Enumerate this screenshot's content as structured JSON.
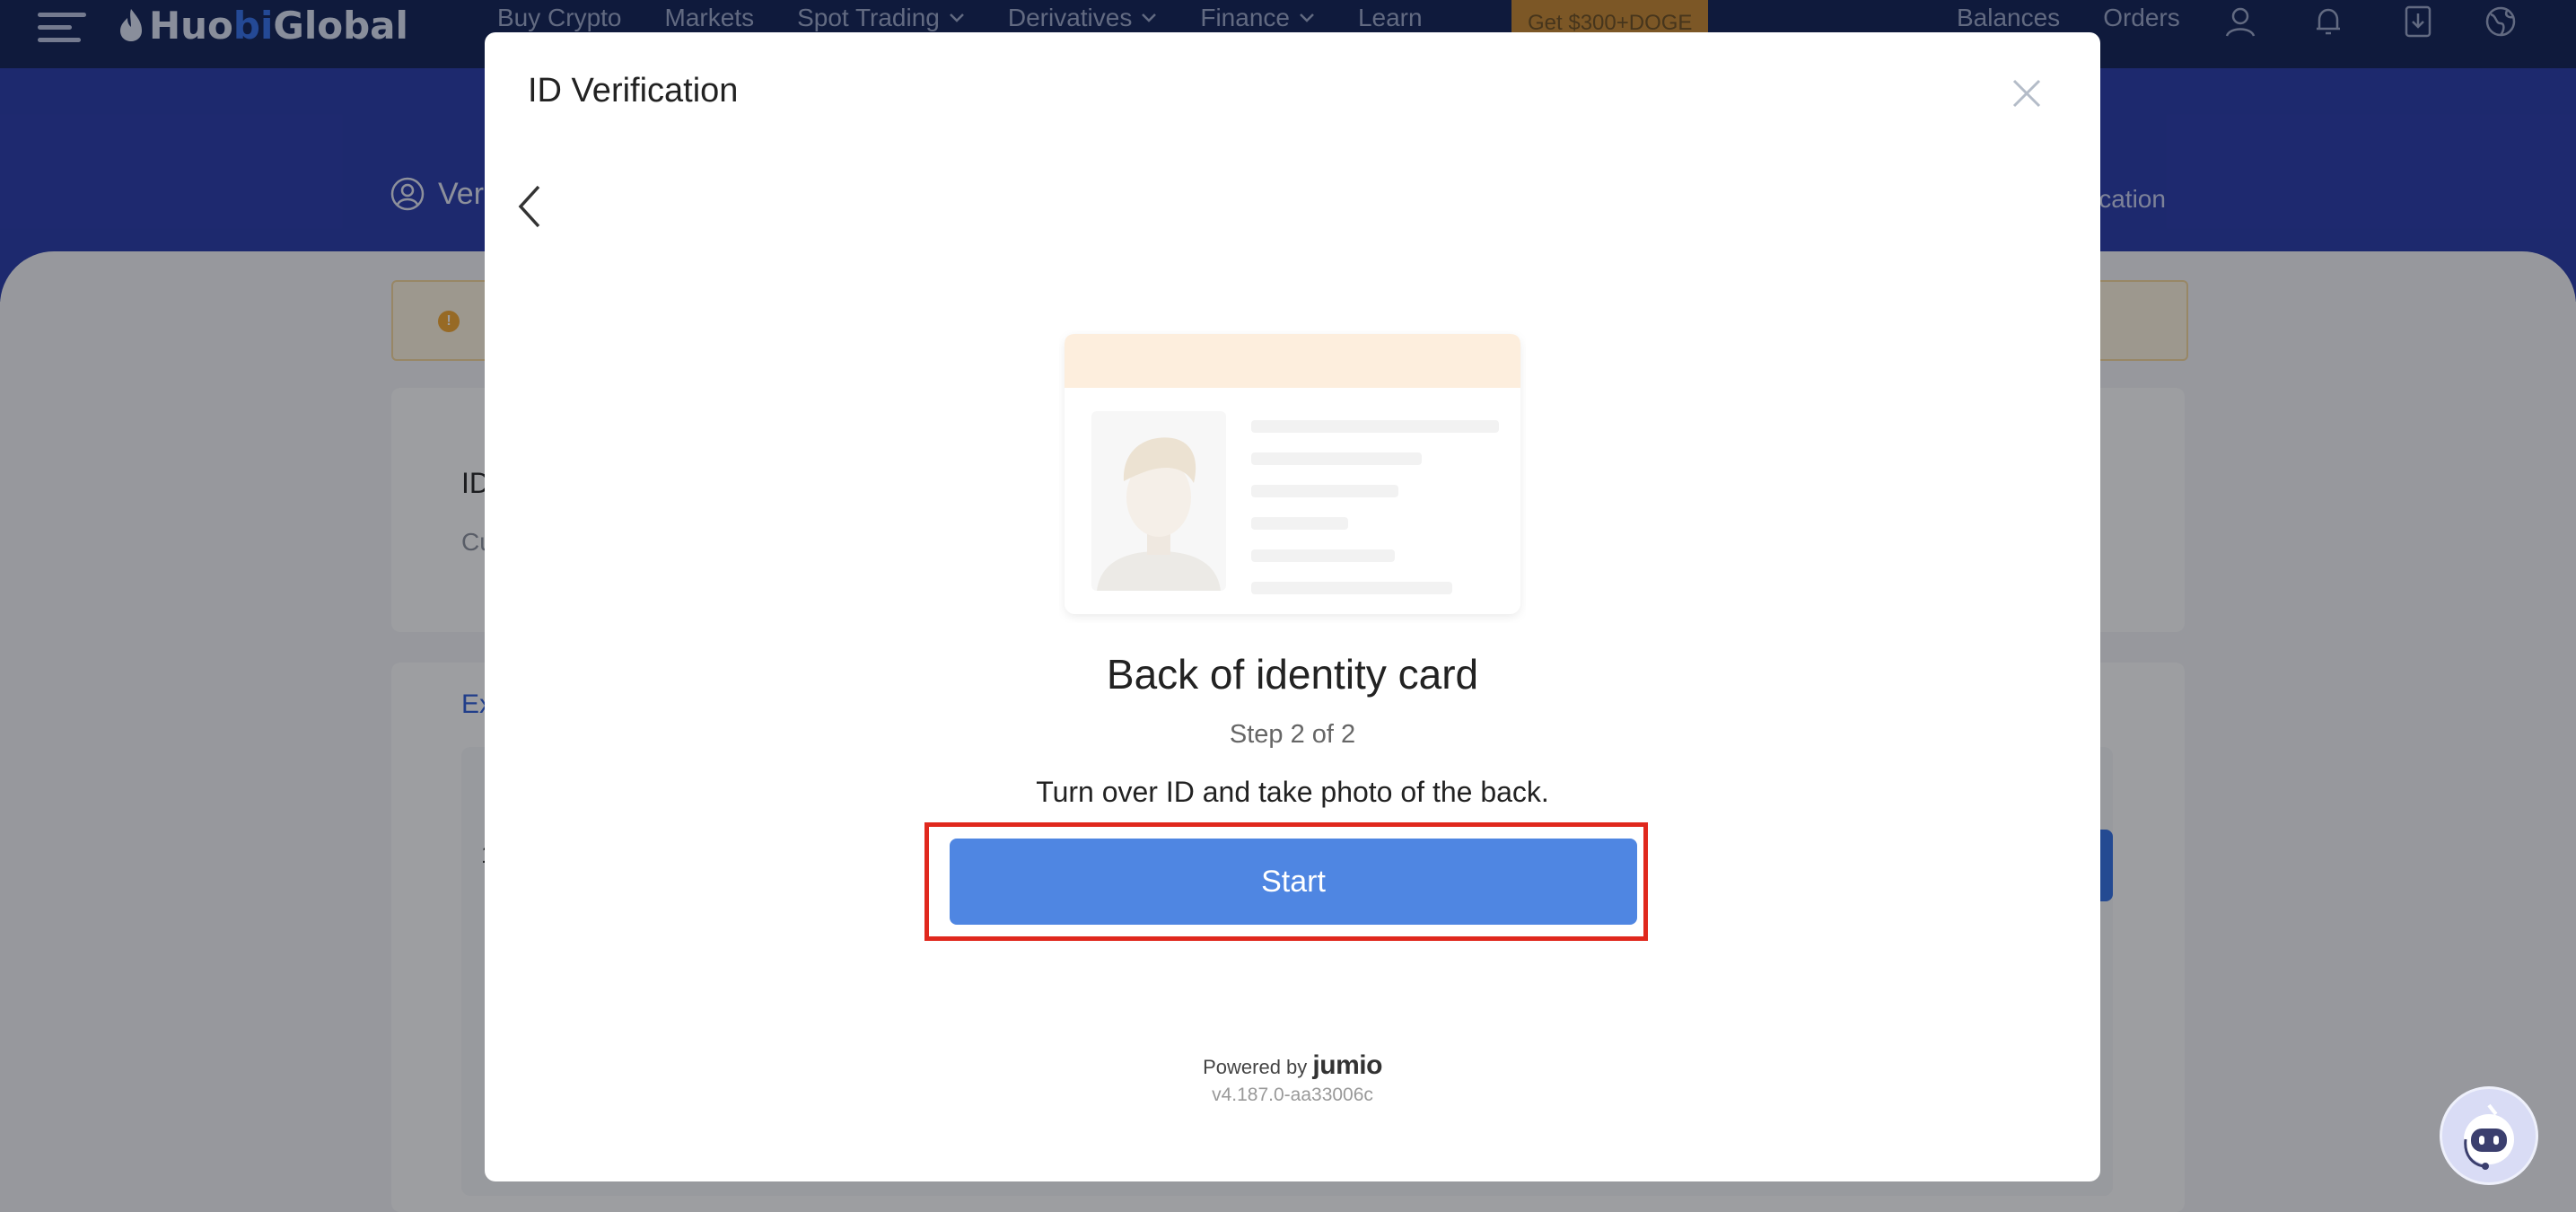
{
  "nav": {
    "logo_left": "Huo",
    "logo_mid": "bi",
    "logo_right": " Global",
    "links": [
      "Buy Crypto",
      "Markets",
      "Spot Trading",
      "Derivatives",
      "Finance",
      "Learn"
    ],
    "promo": "Get $300+DOGE",
    "balances": "Balances",
    "orders": "Orders"
  },
  "background": {
    "hero_title": "Ver",
    "hero_right": "ification",
    "card_heading": "ID",
    "card_sub": "Cu",
    "link_text": "Ex",
    "row_marker": "1"
  },
  "modal": {
    "title": "ID Verification",
    "card_title": "Back of identity card",
    "step": "Step 2 of 2",
    "instruction": "Turn over ID and take photo of the back.",
    "start_label": "Start",
    "powered_by": "Powered by",
    "brand": "jumio",
    "version": "v4.187.0-aa33006c"
  },
  "colors": {
    "nav_bg": "#0b1d52",
    "hero_bg": "#2336a8",
    "start_button": "#4f86e2",
    "highlight": "#e0281d",
    "id_header": "#fdeedd"
  },
  "icons": [
    "menu-icon",
    "huobi-flame-icon",
    "chevron-down-icon",
    "user-icon",
    "bell-icon",
    "download-icon",
    "globe-icon",
    "close-icon",
    "back-arrow-icon",
    "support-bot-icon",
    "warning-icon"
  ]
}
